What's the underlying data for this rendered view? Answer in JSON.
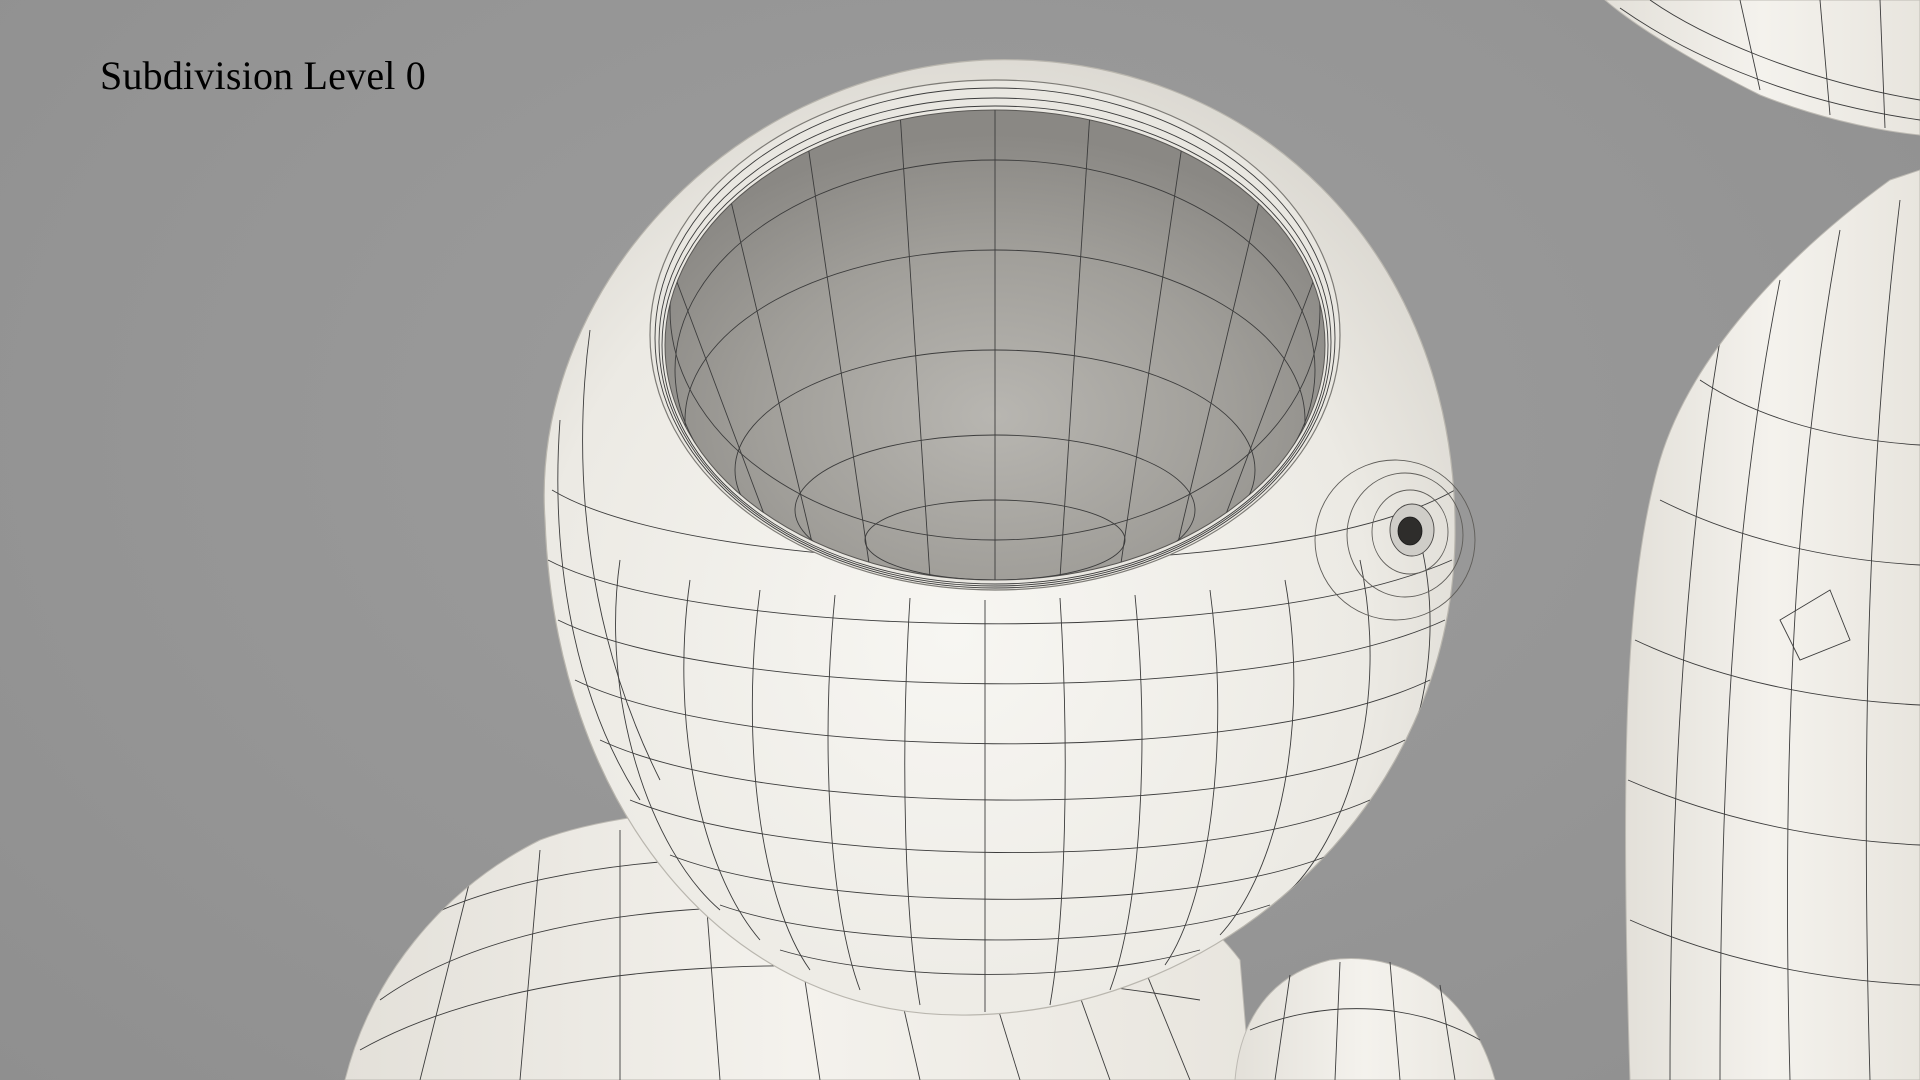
{
  "caption": {
    "text": "Subdivision Level 0"
  },
  "scene": {
    "background_color": "#959595",
    "surface_color": "#f1efea",
    "wire_color": "#3c3c3c"
  }
}
